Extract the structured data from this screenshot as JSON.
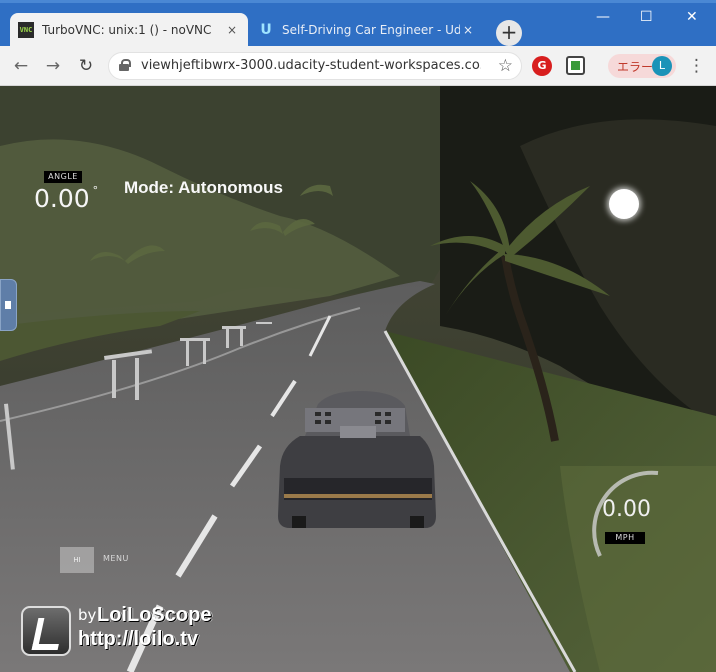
{
  "browser": {
    "tabs": [
      {
        "title": "TurboVNC: unix:1 () - noVNC",
        "favicon": "vnc-favicon",
        "close": "×",
        "active": true
      },
      {
        "title": "Self-Driving Car Engineer - Udaci",
        "favicon": "udacity-favicon",
        "close": "×",
        "active": false
      }
    ],
    "new_tab": "+",
    "window": {
      "minimize": "—",
      "maximize": "☐",
      "close": "✕"
    },
    "nav": {
      "back": "←",
      "forward": "→",
      "reload": "↻"
    },
    "address": {
      "url": "viewhjeftibwrx-3000.udacity-student-workspaces.co...",
      "star": "☆"
    },
    "extensions": {
      "ext1": "G"
    },
    "error_pill": {
      "label": "エラー",
      "avatar": "L"
    },
    "menu": "⋮",
    "accent": "#2f6fc4"
  },
  "simulator": {
    "angle_label": "ANGLE",
    "angle_value": "0.00",
    "angle_unit": "°",
    "mode": "Mode: Autonomous",
    "speed_value": "0.00",
    "speed_label": "MPH",
    "button_small": "HI",
    "menu_label": "MENU"
  },
  "watermark": {
    "by": "by",
    "brand": "LoiLoScope",
    "url": "http://loilo.tv"
  }
}
